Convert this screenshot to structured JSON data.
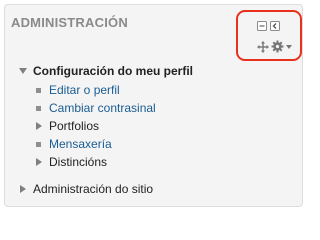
{
  "block": {
    "title": "ADMINISTRACIÓN",
    "controls": {
      "collapse_icon": "minus-box",
      "dock_icon": "dock-left-box",
      "move_icon": "four-arrow-move",
      "actions_icon": "gear-with-caret",
      "highlight_color": "#e7311c"
    },
    "tree": {
      "profile_settings": {
        "label": "Configuración do meu perfil",
        "expanded": true,
        "children": [
          {
            "label": "Editar o perfil",
            "type": "link"
          },
          {
            "label": "Cambiar contrasinal",
            "type": "link"
          },
          {
            "label": "Portfolios",
            "type": "collapsed-node"
          },
          {
            "label": "Mensaxería",
            "type": "link"
          },
          {
            "label": "Distincións",
            "type": "collapsed-node"
          }
        ]
      },
      "site_admin": {
        "label": "Administración do sitio",
        "expanded": false
      }
    }
  },
  "colors": {
    "link": "#1a5d93",
    "text": "#222222",
    "title": "#8a8a8a",
    "block_bg": "#f4f4f4"
  }
}
